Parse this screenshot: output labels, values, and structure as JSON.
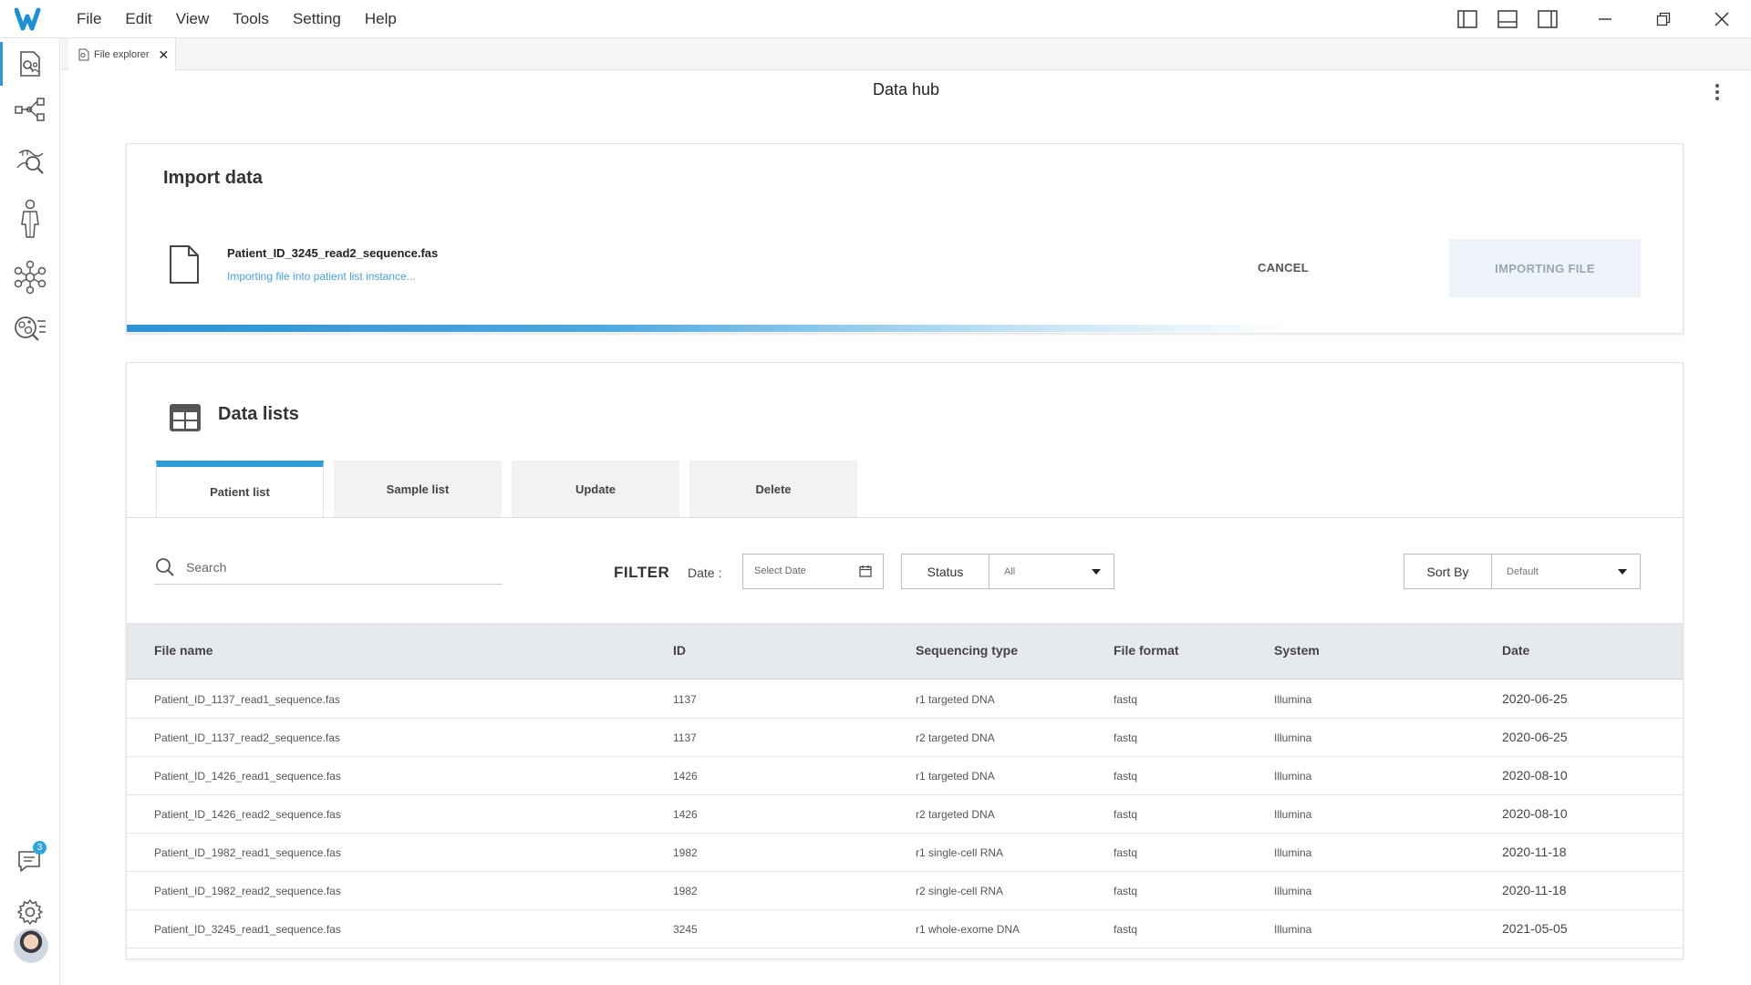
{
  "menu": {
    "items": [
      "File",
      "Edit",
      "View",
      "Tools",
      "Setting",
      "Help"
    ]
  },
  "tab": {
    "label": "File explorer",
    "close": "✕"
  },
  "page": {
    "title": "Data hub"
  },
  "import": {
    "title": "Import data",
    "file_name": "Patient_ID_3245_read2_sequence.fas",
    "status": "Importing file into patient list instance...",
    "cancel_label": "CANCEL",
    "importing_label": "IMPORTING FILE",
    "progress": 0.75
  },
  "lists": {
    "title": "Data lists",
    "tabs": [
      "Patient list",
      "Sample list",
      "Update",
      "Delete"
    ],
    "active_tab": "Patient list"
  },
  "filter": {
    "search_placeholder": "Search",
    "filter_label": "FILTER",
    "date_label": "Date :",
    "date_placeholder": "Select Date",
    "status_label": "Status",
    "status_value": "All",
    "sort_label": "Sort By",
    "sort_value": "Default"
  },
  "table": {
    "columns": [
      "File name",
      "ID",
      "Sequencing type",
      "File format",
      "System",
      "Date"
    ],
    "rows": [
      [
        "Patient_ID_1137_read1_sequence.fas",
        "1137",
        "r1 targeted DNA",
        "fastq",
        "Illumina",
        "2020-06-25"
      ],
      [
        "Patient_ID_1137_read2_sequence.fas",
        "1137",
        "r2 targeted DNA",
        "fastq",
        "Illumina",
        "2020-06-25"
      ],
      [
        "Patient_ID_1426_read1_sequence.fas",
        "1426",
        "r1 targeted DNA",
        "fastq",
        "Illumina",
        "2020-08-10"
      ],
      [
        "Patient_ID_1426_read2_sequence.fas",
        "1426",
        "r2 targeted DNA",
        "fastq",
        "Illumina",
        "2020-08-10"
      ],
      [
        "Patient_ID_1982_read1_sequence.fas",
        "1982",
        "r1 single-cell RNA",
        "fastq",
        "Illumina",
        "2020-11-18"
      ],
      [
        "Patient_ID_1982_read2_sequence.fas",
        "1982",
        "r2 single-cell RNA",
        "fastq",
        "Illumina",
        "2020-11-18"
      ],
      [
        "Patient_ID_3245_read1_sequence.fas",
        "3245",
        "r1 whole-exome DNA",
        "fastq",
        "Illumina",
        "2021-05-05"
      ]
    ]
  },
  "rail": {
    "notification_count": "3"
  },
  "colors": {
    "accent": "#2d9bd6",
    "link": "#4aa3df",
    "logo": "#1d8fd6"
  }
}
